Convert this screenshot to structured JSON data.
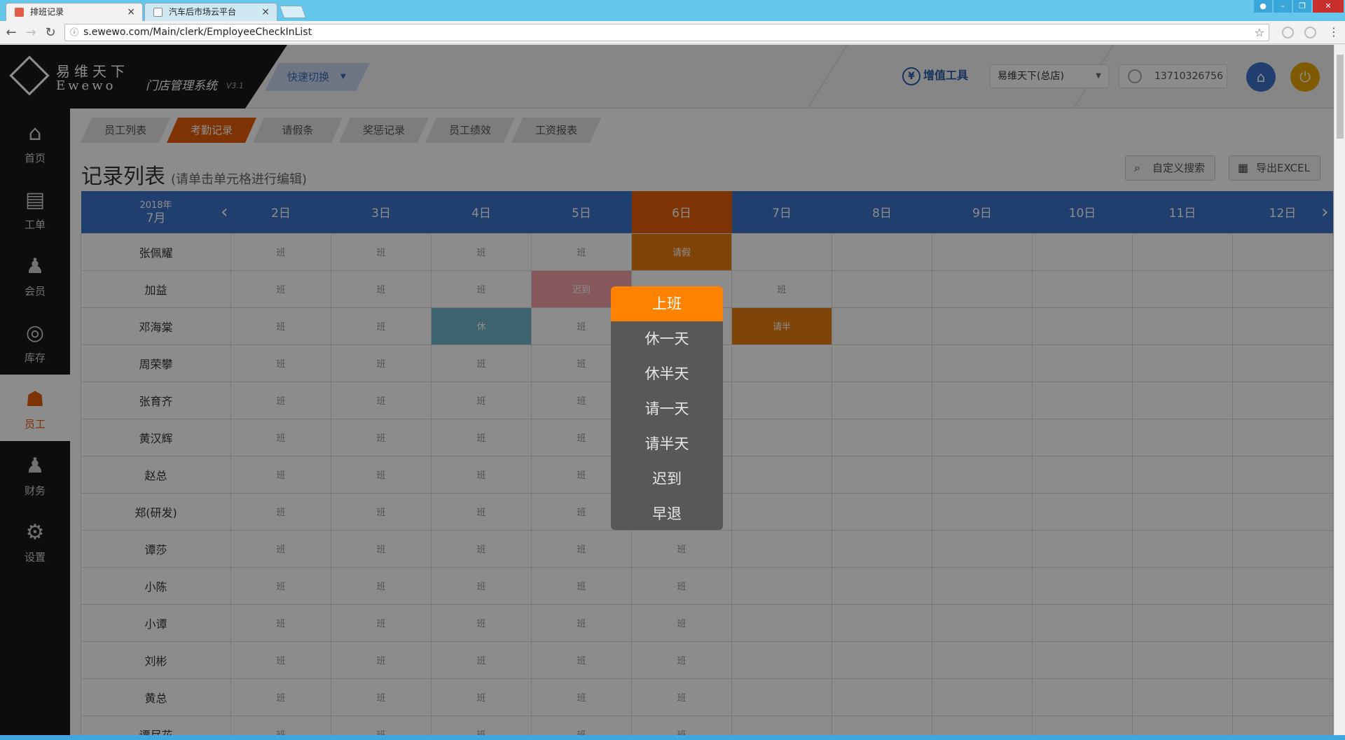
{
  "browser": {
    "tabs": [
      {
        "title": "排班记录",
        "active": true
      },
      {
        "title": "汽车后市场云平台",
        "active": false
      }
    ],
    "url": "s.ewewo.com/Main/clerk/EmployeeCheckInList"
  },
  "header": {
    "brand_cn": "易维天下",
    "brand_en": "Ewewo",
    "system_name": "门店管理系统",
    "version": "V3.1",
    "quick_switch": "快速切换",
    "vat_tools": "增值工具",
    "store": "易维天下(总店)",
    "phone": "13710326756"
  },
  "sidebar": {
    "items": [
      {
        "label": "首页",
        "icon": "home-icon"
      },
      {
        "label": "工单",
        "icon": "work-order-icon"
      },
      {
        "label": "会员",
        "icon": "member-icon"
      },
      {
        "label": "库存",
        "icon": "inventory-icon"
      },
      {
        "label": "员工",
        "icon": "staff-icon",
        "active": true
      },
      {
        "label": "财务",
        "icon": "finance-icon"
      },
      {
        "label": "设置",
        "icon": "settings-icon"
      }
    ]
  },
  "subtabs": [
    "员工列表",
    "考勤记录",
    "请假条",
    "奖惩记录",
    "员工绩效",
    "工资报表"
  ],
  "page": {
    "title": "记录列表",
    "hint": "(请单击单元格进行编辑)",
    "search_btn": "自定义搜索",
    "export_btn": "导出EXCEL"
  },
  "grid": {
    "year": "2018年",
    "month": "7月",
    "days": [
      "2日",
      "3日",
      "4日",
      "5日",
      "6日",
      "7日",
      "8日",
      "9日",
      "10日",
      "11日",
      "12日"
    ],
    "rows": [
      {
        "name": "张佩耀",
        "cells": [
          "班",
          "班",
          "班",
          "班",
          "请假",
          "",
          "",
          "",
          "",
          "",
          ""
        ]
      },
      {
        "name": "加益",
        "cells": [
          "班",
          "班",
          "班",
          "迟到",
          "",
          "班",
          "",
          "",
          "",
          "",
          ""
        ]
      },
      {
        "name": "邓海棠",
        "cells": [
          "班",
          "班",
          "休",
          "班",
          "",
          "请半",
          "",
          "",
          "",
          "",
          ""
        ]
      },
      {
        "name": "周荣攀",
        "cells": [
          "班",
          "班",
          "班",
          "班",
          "",
          "",
          "",
          "",
          "",
          "",
          ""
        ]
      },
      {
        "name": "张育齐",
        "cells": [
          "班",
          "班",
          "班",
          "班",
          "",
          "",
          "",
          "",
          "",
          "",
          ""
        ]
      },
      {
        "name": "黄汉辉",
        "cells": [
          "班",
          "班",
          "班",
          "班",
          "",
          "",
          "",
          "",
          "",
          "",
          ""
        ]
      },
      {
        "name": "赵总",
        "cells": [
          "班",
          "班",
          "班",
          "班",
          "",
          "",
          "",
          "",
          "",
          "",
          ""
        ]
      },
      {
        "name": "郑(研发)",
        "cells": [
          "班",
          "班",
          "班",
          "班",
          "",
          "",
          "",
          "",
          "",
          "",
          ""
        ]
      },
      {
        "name": "谭莎",
        "cells": [
          "班",
          "班",
          "班",
          "班",
          "班",
          "",
          "",
          "",
          "",
          "",
          ""
        ]
      },
      {
        "name": "小陈",
        "cells": [
          "班",
          "班",
          "班",
          "班",
          "班",
          "",
          "",
          "",
          "",
          "",
          ""
        ]
      },
      {
        "name": "小谭",
        "cells": [
          "班",
          "班",
          "班",
          "班",
          "班",
          "",
          "",
          "",
          "",
          "",
          ""
        ]
      },
      {
        "name": "刘彬",
        "cells": [
          "班",
          "班",
          "班",
          "班",
          "班",
          "",
          "",
          "",
          "",
          "",
          ""
        ]
      },
      {
        "name": "黄总",
        "cells": [
          "班",
          "班",
          "班",
          "班",
          "班",
          "",
          "",
          "",
          "",
          "",
          ""
        ]
      },
      {
        "name": "谭尽花",
        "cells": [
          "班",
          "班",
          "班",
          "班",
          "班",
          "",
          "",
          "",
          "",
          "",
          ""
        ]
      }
    ]
  },
  "popup": {
    "options": [
      "上班",
      "休一天",
      "休半天",
      "请一天",
      "请半天",
      "迟到",
      "早退"
    ]
  },
  "colors": {
    "accent_orange": "#e35d06",
    "header_blue": "#3d74c8",
    "popup_active": "#ff8200"
  }
}
